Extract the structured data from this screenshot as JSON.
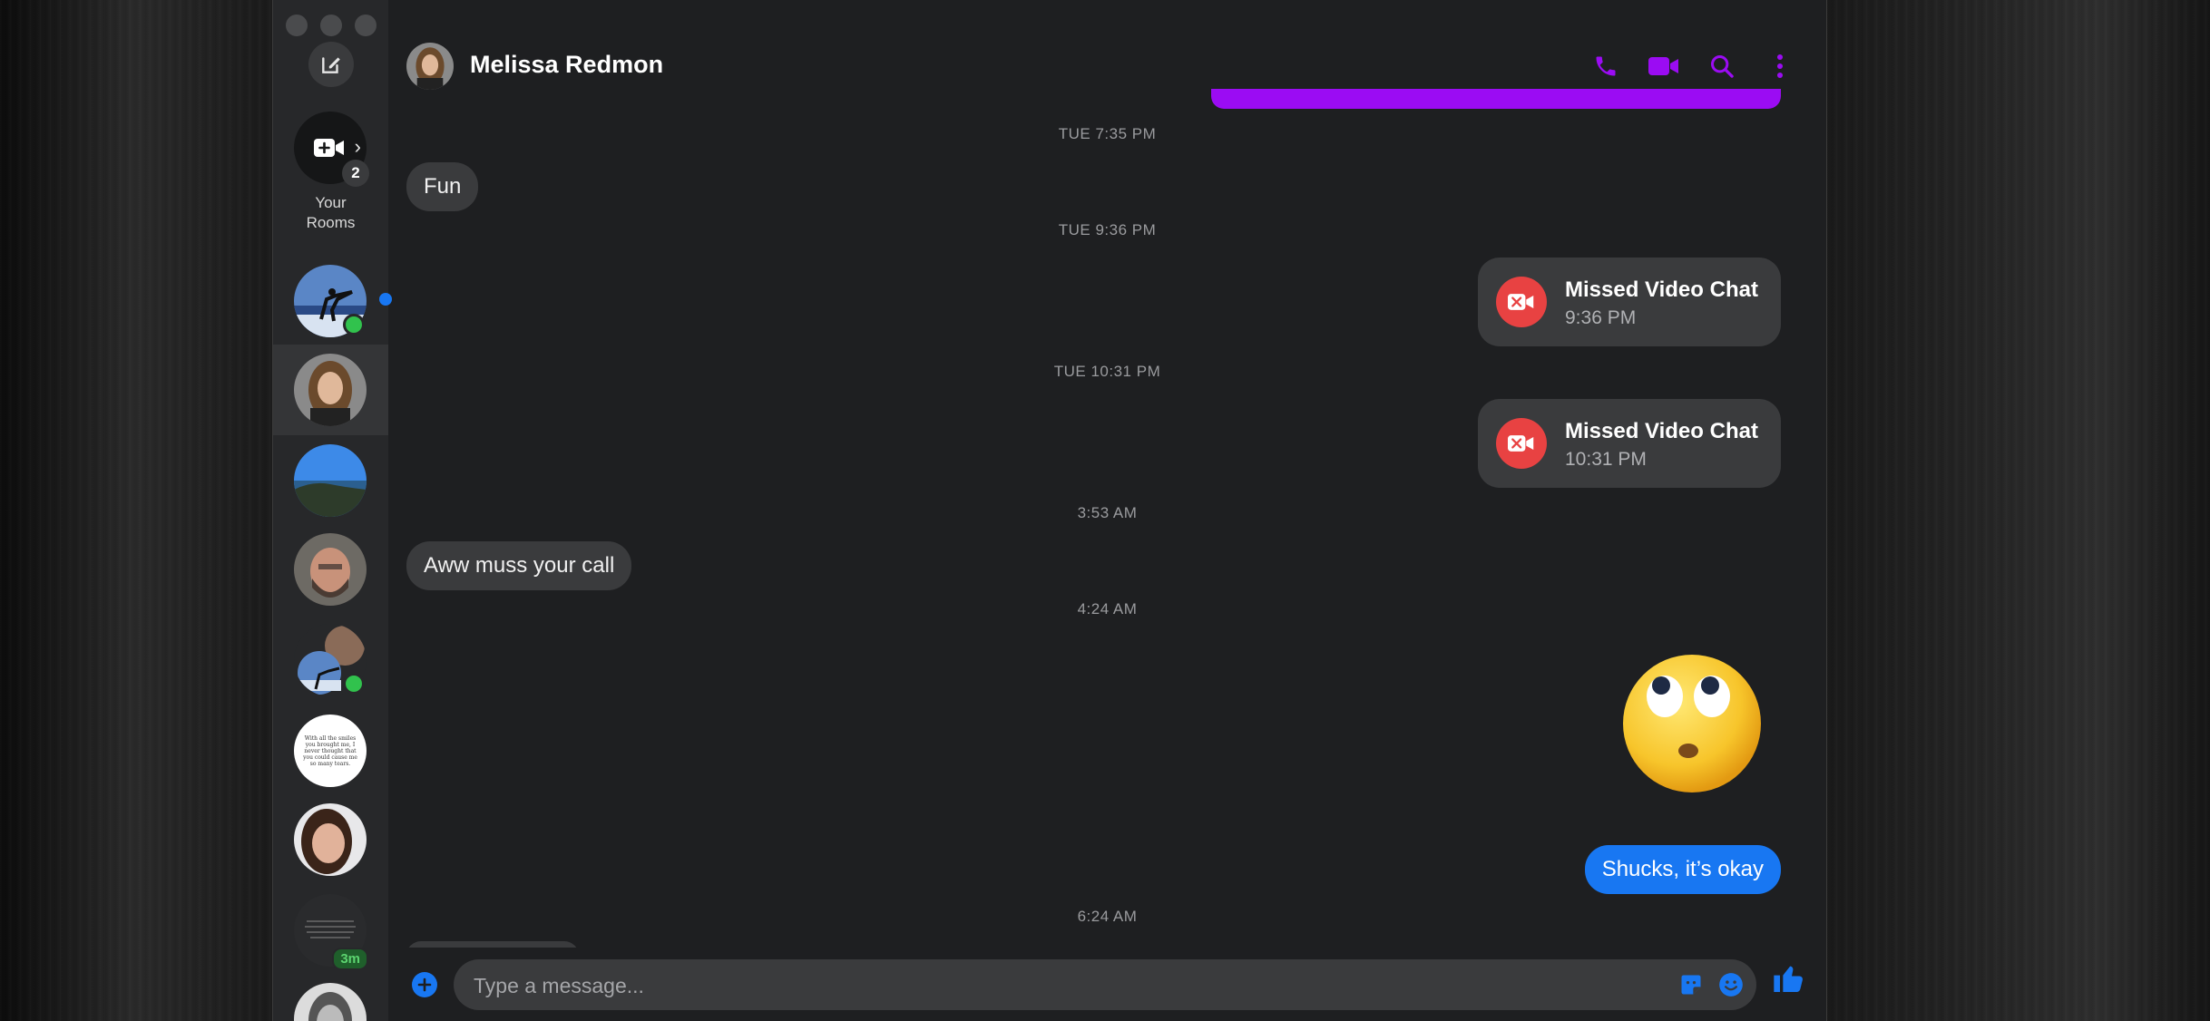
{
  "conversation": {
    "contact_name": "Melissa Redmon"
  },
  "sidebar": {
    "rooms_label": "Your\nRooms",
    "rooms_count": "2",
    "contacts": [
      {
        "id": "karate-group",
        "online": true,
        "unread": true
      },
      {
        "id": "melissa",
        "online": false,
        "active": true
      },
      {
        "id": "landscape",
        "online": false
      },
      {
        "id": "bearded-man",
        "online": false
      },
      {
        "id": "group-2",
        "online": true
      },
      {
        "id": "quote-card",
        "quote_text": "With all the smiles you brought me, I never thought that you could cause me so many tears."
      },
      {
        "id": "woman-dark-hair",
        "online": false
      },
      {
        "id": "quote-card-2",
        "time_badge": "3m"
      },
      {
        "id": "woman-grey"
      }
    ]
  },
  "messages": {
    "stamps": [
      "TUE 7:35 PM",
      "TUE 9:36 PM",
      "TUE 10:31 PM",
      "3:53 AM",
      "4:24 AM",
      "6:24 AM"
    ],
    "incoming_1": "Fun",
    "missed_1": {
      "title": "Missed Video Chat",
      "time": "9:36 PM"
    },
    "missed_2": {
      "title": "Missed Video Chat",
      "time": "10:31 PM"
    },
    "incoming_2": "Aww muss your call",
    "outgoing_1": "Shucks, it’s okay"
  },
  "composer": {
    "placeholder": "Type a message..."
  },
  "colors": {
    "accent_purple": "#9b0cf3",
    "messenger_blue": "#1877f2",
    "missed_red": "#e84242",
    "online_green": "#31c24d"
  },
  "icons": [
    "compose-icon",
    "video-room-icon",
    "phone-icon",
    "video-camera-icon",
    "search-icon",
    "more-vertical-icon",
    "missed-video-icon",
    "plus-icon",
    "sticker-icon",
    "emoji-icon",
    "thumbs-up-icon"
  ]
}
